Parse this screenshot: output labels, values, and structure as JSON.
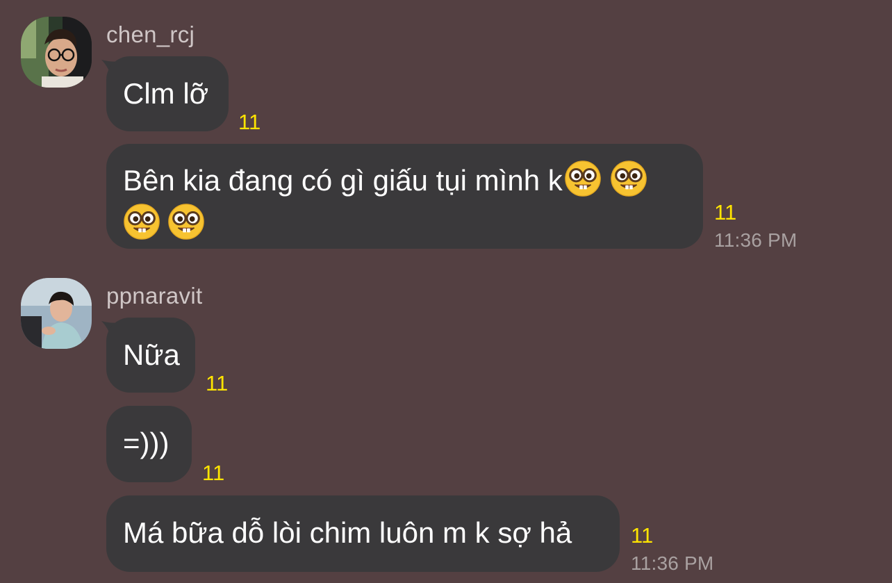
{
  "messages_group_1": {
    "sender": "chen_rcj",
    "messages": [
      {
        "text": "Clm lỡ",
        "count": "11"
      },
      {
        "text_line1": "Bên kia đang có gì giấu tụi mình k",
        "text_line2": "",
        "count": "11",
        "time": "11:36 PM"
      }
    ]
  },
  "messages_group_2": {
    "sender": "ppnaravit",
    "messages": [
      {
        "text": "Nữa",
        "count": "11"
      },
      {
        "text": "=)))",
        "count": "11"
      },
      {
        "text": "Má bữa dỗ lòi chim luôn m k sợ hả",
        "count": "11",
        "time": "11:36 PM"
      }
    ]
  },
  "icons": {
    "emoji": "nerd-face",
    "avatar_1": "profile-photo-chen_rcj",
    "avatar_2": "profile-photo-ppnaravit"
  },
  "colors": {
    "background": "#544042",
    "bubble": "#3a393b",
    "read_count": "#ffe400",
    "timestamp": "#a9a1a1",
    "username": "#cfc6c6"
  }
}
